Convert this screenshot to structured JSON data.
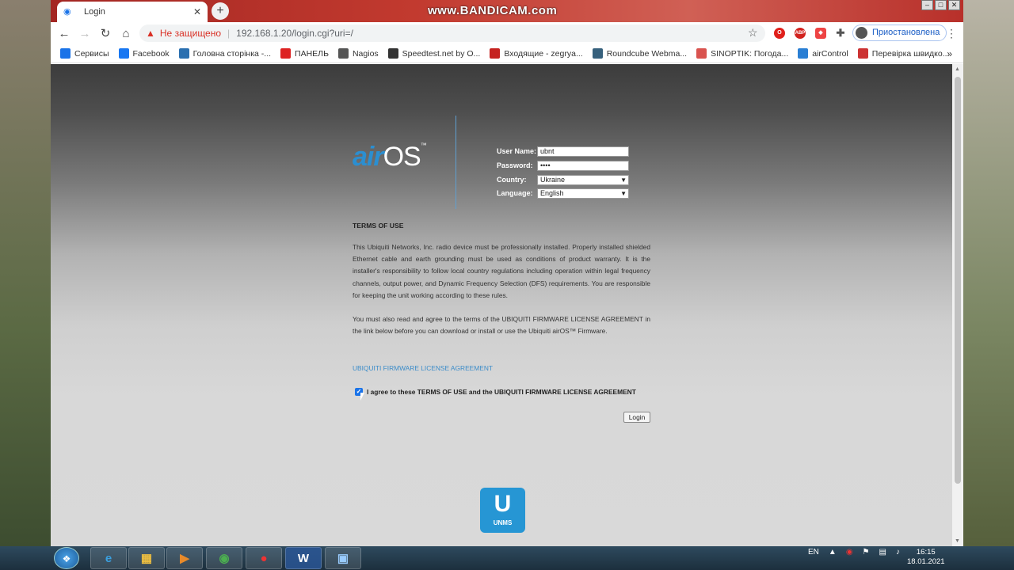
{
  "browser": {
    "tab_title": "Login",
    "recording_watermark": "www.BANDICAM.com",
    "not_secure_label": "Не защищено",
    "url": "192.168.1.20/login.cgi?uri=/",
    "profile_status": "Приостановлена",
    "ext_abp": "ABP",
    "ext_mini": "0 0 0"
  },
  "bookmarks": [
    {
      "label": "Сервисы",
      "icon": "apps-icon",
      "color": "#1a73e8"
    },
    {
      "label": "Facebook",
      "icon": "facebook-icon",
      "color": "#1877f2"
    },
    {
      "label": "Головна сторінка -...",
      "icon": "bookmark-icon",
      "color": "#2a6fb0"
    },
    {
      "label": "ПАНЕЛЬ",
      "icon": "z-icon",
      "color": "#d22"
    },
    {
      "label": "Nagios",
      "icon": "nagios-icon",
      "color": "#555"
    },
    {
      "label": "Speedtest.net by O...",
      "icon": "speedtest-icon",
      "color": "#333"
    },
    {
      "label": "Входящие - zegrya...",
      "icon": "gmail-icon",
      "color": "#c5221f"
    },
    {
      "label": "Roundcube Webma...",
      "icon": "roundcube-icon",
      "color": "#37617d"
    },
    {
      "label": "SINOPTIK: Погода...",
      "icon": "sinoptik-icon",
      "color": "#d9534f"
    },
    {
      "label": "airControl",
      "icon": "aircontrol-icon",
      "color": "#2a7fd4"
    },
    {
      "label": "Перевірка швидко...",
      "icon": "speedcheck-icon",
      "color": "#c33"
    }
  ],
  "login": {
    "username_label": "User Name:",
    "username_value": "ubnt",
    "password_label": "Password:",
    "password_value": "••••",
    "country_label": "Country:",
    "country_value": "Ukraine",
    "language_label": "Language:",
    "language_value": "English",
    "logo_air": "air",
    "logo_os": "OS",
    "logo_tm": "™"
  },
  "terms": {
    "title": "TERMS OF USE",
    "paragraph1": "This Ubiquiti Networks, Inc. radio device must be professionally installed. Properly installed shielded Ethernet cable and earth grounding must be used as conditions of product warranty. It is the installer's responsibility to follow local country regulations including operation within legal frequency channels, output power, and Dynamic Frequency Selection (DFS) requirements. You are responsible for keeping the unit working according to these rules.",
    "paragraph2": "You must also read and agree to the terms of the UBIQUITI FIRMWARE LICENSE AGREEMENT in the link below before you can download or install or use the Ubiquiti airOS™ Firmware.",
    "license_link": "UBIQUITI FIRMWARE LICENSE AGREEMENT",
    "agree_text": "I agree to these TERMS OF USE and the UBIQUITI FIRMWARE LICENSE AGREEMENT",
    "agree_checked": true,
    "login_button": "Login"
  },
  "unms": {
    "label": "UNMS",
    "icon_letter": "U"
  },
  "taskbar": {
    "lang": "EN",
    "time": "16:15",
    "date": "18.01.2021",
    "apps": [
      "internet-explorer",
      "file-explorer",
      "media-player",
      "chrome",
      "bandicam",
      "word",
      "control-panel"
    ]
  }
}
